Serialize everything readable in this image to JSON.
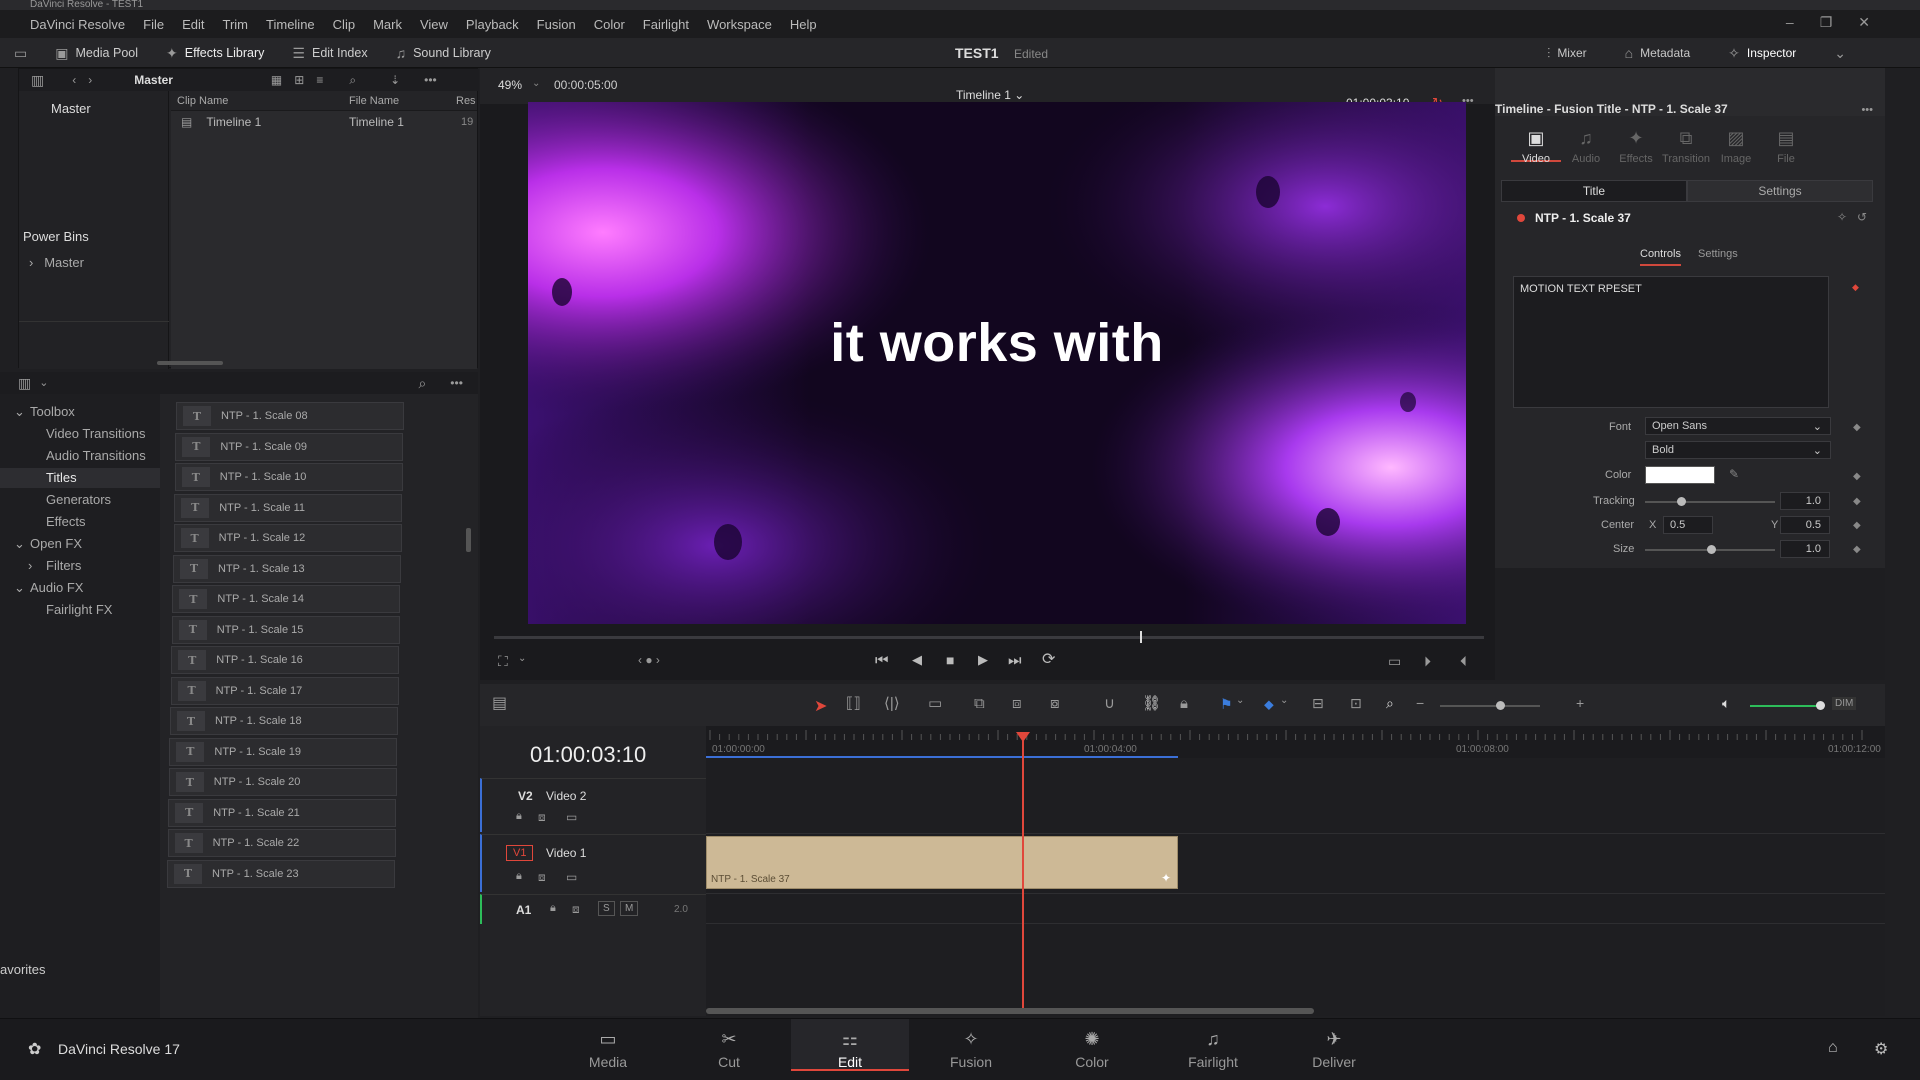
{
  "app": {
    "window_title": "DaVinci Resolve - TEST1",
    "brand": "DaVinci Resolve 17"
  },
  "menu": [
    "DaVinci Resolve",
    "File",
    "Edit",
    "Trim",
    "Timeline",
    "Clip",
    "Mark",
    "View",
    "Playback",
    "Fusion",
    "Color",
    "Fairlight",
    "Workspace",
    "Help"
  ],
  "toolbar": {
    "media_pool": "Media Pool",
    "effects_library": "Effects Library",
    "edit_index": "Edit Index",
    "sound_library": "Sound Library",
    "project_title": "TEST1",
    "project_status": "Edited",
    "mixer": "Mixer",
    "metadata": "Metadata",
    "inspector": "Inspector"
  },
  "media_pool": {
    "bin_title": "Master",
    "master_bin": "Master",
    "power_bins": "Power Bins",
    "power_bins_master": "Master",
    "columns": {
      "clip_name": "Clip Name",
      "file_name": "File Name",
      "res": "Res"
    },
    "clips": [
      {
        "name": "Timeline 1",
        "file": "Timeline 1",
        "res": "19"
      }
    ]
  },
  "effects": {
    "tree": [
      {
        "label": "Toolbox",
        "level": 0,
        "arrow": "v"
      },
      {
        "label": "Video Transitions",
        "level": 1
      },
      {
        "label": "Audio Transitions",
        "level": 1
      },
      {
        "label": "Titles",
        "level": 1,
        "selected": true
      },
      {
        "label": "Generators",
        "level": 1
      },
      {
        "label": "Effects",
        "level": 1
      },
      {
        "label": "Open FX",
        "level": 0,
        "arrow": "v"
      },
      {
        "label": "Filters",
        "level": 1,
        "arrow": ">"
      },
      {
        "label": "Audio FX",
        "level": 0,
        "arrow": "v"
      },
      {
        "label": "Fairlight FX",
        "level": 1
      }
    ],
    "favorites": "avorites",
    "titles": [
      "NTP - 1. Scale 08",
      "NTP - 1. Scale 09",
      "NTP - 1. Scale 10",
      "NTP - 1. Scale 11",
      "NTP - 1. Scale 12",
      "NTP - 1. Scale 13",
      "NTP - 1. Scale 14",
      "NTP - 1. Scale 15",
      "NTP - 1. Scale 16",
      "NTP - 1. Scale 17",
      "NTP - 1. Scale 18",
      "NTP - 1. Scale 19",
      "NTP - 1. Scale 20",
      "NTP - 1. Scale 21",
      "NTP - 1. Scale 22",
      "NTP - 1. Scale 23"
    ]
  },
  "viewer": {
    "zoom": "49%",
    "duration": "00:00:05:00",
    "timeline_name": "Timeline 1",
    "timecode": "01:00:03:10",
    "overlay_text": "it works with"
  },
  "inspector": {
    "header": "Timeline - Fusion Title - NTP - 1. Scale 37",
    "tabs": [
      "Video",
      "Audio",
      "Effects",
      "Transition",
      "Image",
      "File"
    ],
    "sub_tabs": [
      "Title",
      "Settings"
    ],
    "item_name": "NTP - 1. Scale 37",
    "controls_tabs": [
      "Controls",
      "Settings"
    ],
    "text_value": "MOTION TEXT RPESET",
    "font_label": "Font",
    "font": "Open Sans",
    "style": "Bold",
    "color_label": "Color",
    "color_value": "#ffffff",
    "tracking_label": "Tracking",
    "tracking": "1.0",
    "center_label": "Center",
    "center_x_label": "X",
    "center_x": "0.5",
    "center_y_label": "Y",
    "center_y": "0.5",
    "size_label": "Size",
    "size": "1.0"
  },
  "timeline": {
    "timecode": "01:00:03:10",
    "ruler": [
      "01:00:00:00",
      "01:00:04:00",
      "01:00:08:00",
      "01:00:12:00"
    ],
    "tracks": [
      {
        "id": "V2",
        "name": "Video 2"
      },
      {
        "id": "V1",
        "name": "Video 1"
      },
      {
        "id": "A1",
        "name": "",
        "level": "2.0"
      }
    ],
    "clip_label": "NTP - 1. Scale 37",
    "audio_s": "S",
    "audio_m": "M",
    "dim": "DIM"
  },
  "pages": [
    {
      "label": "Media",
      "icon": "media-icon"
    },
    {
      "label": "Cut",
      "icon": "cut-icon"
    },
    {
      "label": "Edit",
      "icon": "edit-icon",
      "active": true
    },
    {
      "label": "Fusion",
      "icon": "fusion-icon"
    },
    {
      "label": "Color",
      "icon": "color-icon"
    },
    {
      "label": "Fairlight",
      "icon": "fairlight-icon"
    },
    {
      "label": "Deliver",
      "icon": "deliver-icon"
    }
  ],
  "colors": {
    "accent": "#e0473b",
    "clip": "#cdb996"
  }
}
